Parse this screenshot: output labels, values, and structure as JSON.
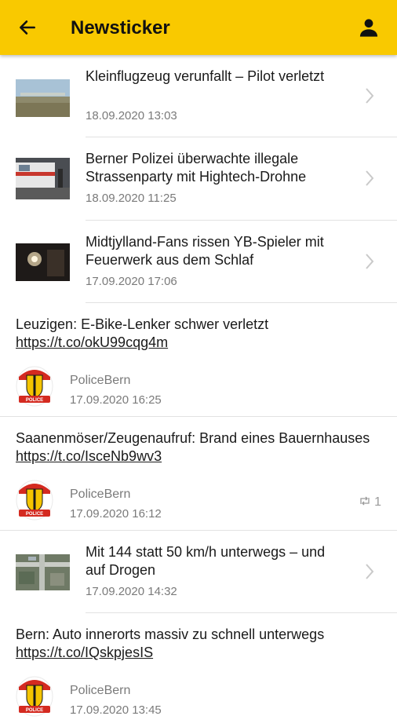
{
  "app_bar": {
    "title": "Newsticker",
    "back_icon": "arrow-left-icon",
    "profile_icon": "person-icon",
    "accent_color": "#f9c900"
  },
  "feed": {
    "news": [
      {
        "headline": "Kleinflugzeug verunfallt – Pilot verletzt",
        "date": "18.09.2020 13:03"
      },
      {
        "headline": "Berner Polizei überwachte illegale Strassenparty mit Hightech-Drohne",
        "date": "18.09.2020 11:25"
      },
      {
        "headline": "Midtjylland-Fans rissen YB-Spieler mit Feuerwerk aus dem Schlaf",
        "date": "17.09.2020 17:06"
      },
      {
        "headline": "Mit 144 statt 50 km/h unterwegs – und auf Drogen",
        "date": "17.09.2020 14:32"
      }
    ],
    "tweets": [
      {
        "text": "Leuzigen: E-Bike-Lenker schwer verletzt",
        "link": "https://t.co/okU99cqg4m",
        "author": "PoliceBern",
        "date": "17.09.2020 16:25",
        "avatar_text": "POLICE"
      },
      {
        "text": "Saanenmöser/Zeugenaufruf: Brand eines Bauernhauses",
        "link": "https://t.co/IsceNb9wv3",
        "author": "PoliceBern",
        "date": "17.09.2020 16:12",
        "avatar_text": "POLICE",
        "retweets": "1"
      },
      {
        "text": "Bern: Auto innerorts massiv zu schnell unterwegs",
        "link": "https://t.co/IQskpjesIS",
        "author": "PoliceBern",
        "date": "17.09.2020 13:45",
        "avatar_text": "POLICE"
      }
    ]
  }
}
